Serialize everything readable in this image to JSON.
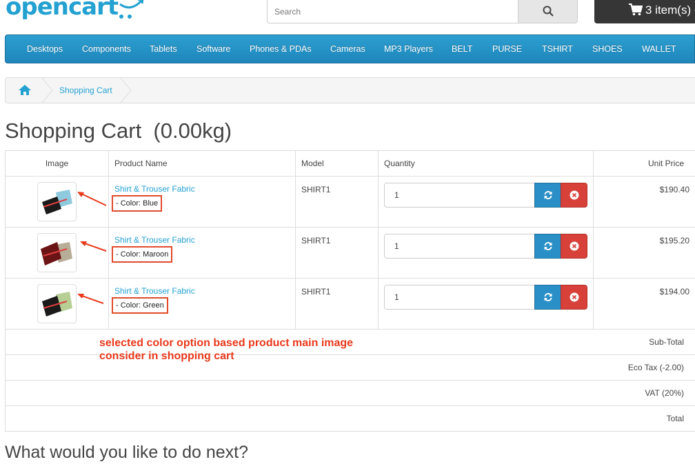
{
  "header": {
    "logo_text": "opencart",
    "search_placeholder": "Search",
    "cart_label": "3 item(s) -"
  },
  "menu": [
    {
      "label": "Desktops"
    },
    {
      "label": "Components"
    },
    {
      "label": "Tablets"
    },
    {
      "label": "Software"
    },
    {
      "label": "Phones & PDAs"
    },
    {
      "label": "Cameras"
    },
    {
      "label": "MP3 Players"
    },
    {
      "label": "BELT"
    },
    {
      "label": "PURSE"
    },
    {
      "label": "TSHIRT"
    },
    {
      "label": "SHOES"
    },
    {
      "label": "WALLET"
    }
  ],
  "breadcrumb": {
    "current": "Shopping Cart"
  },
  "page": {
    "title": "Shopping Cart  (0.00kg)",
    "next_heading": "What would you like to do next?"
  },
  "table": {
    "headers": {
      "image": "Image",
      "name": "Product Name",
      "model": "Model",
      "quantity": "Quantity",
      "unit_price": "Unit Price"
    },
    "rows": [
      {
        "name": "Shirt & Trouser Fabric",
        "option": "- Color: Blue",
        "model": "SHIRT1",
        "quantity": "1",
        "price": "$190.40",
        "thumb_color": "#8ec9de"
      },
      {
        "name": "Shirt & Trouser Fabric",
        "option": "- Color: Maroon",
        "model": "SHIRT1",
        "quantity": "1",
        "price": "$195.20",
        "thumb_color": "#6b1416"
      },
      {
        "name": "Shirt & Trouser Fabric",
        "option": "- Color: Green",
        "model": "SHIRT1",
        "quantity": "1",
        "price": "$194.00",
        "thumb_color": "#b7cf94"
      }
    ],
    "totals": [
      {
        "label": "Sub-Total"
      },
      {
        "label": "Eco Tax (-2.00)"
      },
      {
        "label": "VAT (20%)"
      },
      {
        "label": "Total"
      }
    ]
  },
  "annotation": {
    "line1": "selected color option based product main image",
    "line2": "consider in shopping cart"
  },
  "colors": {
    "brand": "#23a1d1",
    "menu": "#2289c0",
    "annotation": "#e8391c",
    "update_button": "#2a8fc7",
    "remove_button": "#d7413a"
  },
  "icons": {
    "search": "search-icon",
    "cart": "shopping-cart-icon",
    "home": "home-icon",
    "update": "refresh-icon",
    "remove": "remove-circle-icon"
  }
}
